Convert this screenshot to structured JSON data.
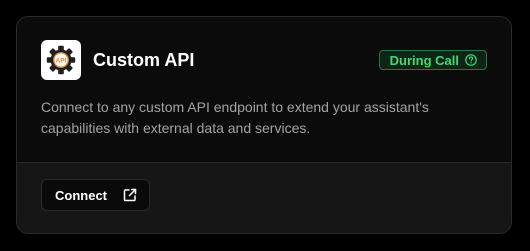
{
  "integration": {
    "logo_text": "API",
    "title": "Custom API",
    "badge_label": "During Call",
    "description": "Connect to any custom API endpoint to extend your assistant's capabilities with external data and services.",
    "connect_label": "Connect"
  },
  "icons": {
    "logo": "gear-api-icon",
    "badge": "help-circle-icon",
    "connect": "external-link-icon"
  },
  "colors": {
    "page_bg": "#000000",
    "card_bg": "#0b0b0b",
    "footer_bg": "#161616",
    "badge_text": "#3ddc74",
    "badge_border": "#1f7a3f",
    "logo_gear": "#1f1f1f",
    "logo_api_ring": "#e8892b"
  }
}
